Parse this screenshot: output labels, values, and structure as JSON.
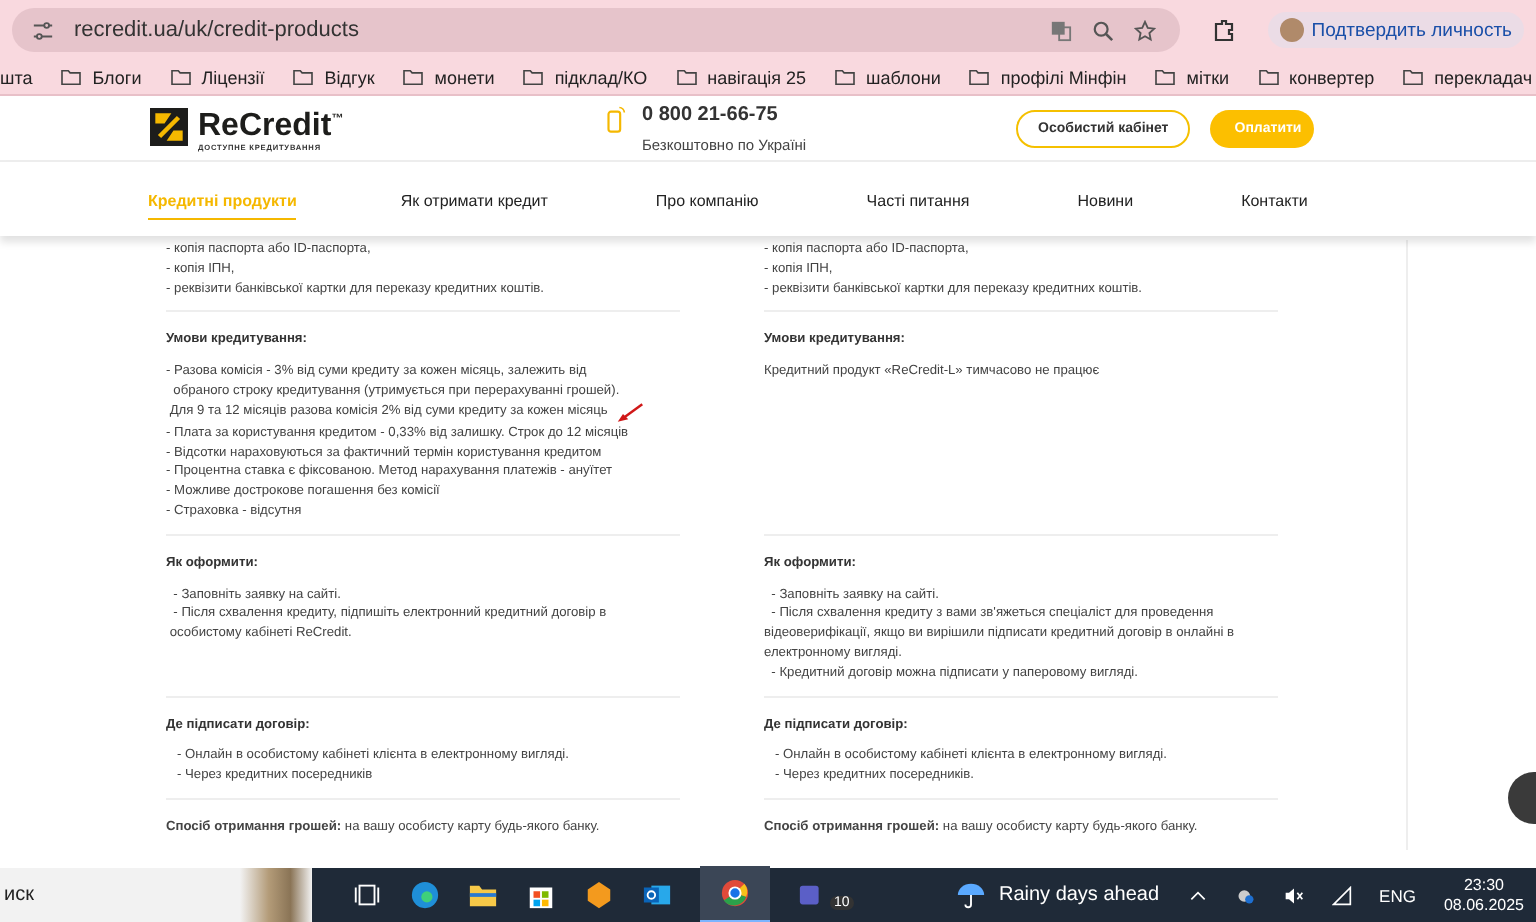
{
  "browser": {
    "url": "recredit.ua/uk/credit-products",
    "profile_button": "Подтвердить личность"
  },
  "bookmarks": [
    "шта",
    "Блоги",
    "Ліцензії",
    "Відгук",
    "монети",
    "підклад/КО",
    "навігація 25",
    "шаблони",
    "профілі Мінфін",
    "мітки",
    "конвертер",
    "перекладач"
  ],
  "header": {
    "logo": "ReCredit",
    "logo_tm": "™",
    "tagline": "ДОСТУПНЕ КРЕДИТУВАННЯ",
    "phone": "0 800 21-66-75",
    "phone_note": "Безкоштовно по Україні",
    "cabinet_button": "Особистий кабінет",
    "pay_button": "Оплатити"
  },
  "nav": [
    {
      "label": "Кредитні продукти",
      "selected": true
    },
    {
      "label": "Як отримати кредит",
      "selected": false
    },
    {
      "label": "Про компанію",
      "selected": false
    },
    {
      "label": "Часті питання",
      "selected": false
    },
    {
      "label": "Новини",
      "selected": false
    },
    {
      "label": "Контакти",
      "selected": false
    }
  ],
  "columns": [
    {
      "sections": [
        {
          "lines": [
            {
              "text": "- копія паспорта або ID-паспорта,",
              "marked": false
            },
            {
              "text": "- копія ІПН,",
              "marked": false
            },
            {
              "text": "- реквізити банківської картки для переказу кредитних коштів.",
              "marked": false
            }
          ]
        },
        {
          "heading": "Умови кредитування:",
          "lines": [
            {
              "text": "- Разова комісія - 3% від суми кредиту за кожен місяць, залежить від",
              "marked": false
            },
            {
              "text": "  обраного строку кредитування (утримується при перерахуванні грошей).",
              "marked": false
            },
            {
              "text": " Для 9 та 12 місяців разова комісія 2% від суми кредиту за кожен місяць",
              "marked": true
            },
            {
              "text": "- Плата за користування кредитом - 0,33% від залишку. Строк до 12 місяців",
              "marked": false
            },
            {
              "text": "- Відсотки нараховуються за фактичний термін користування кредитом",
              "marked": false
            },
            {
              "text": "- Процентна ставка є фіксованою. Метод нарахування платежів - ануїтет",
              "marked": false
            },
            {
              "text": "- Можливе дострокове погашення без комісії",
              "marked": false
            },
            {
              "text": "- Страховка - відсутня",
              "marked": false
            }
          ]
        },
        {
          "heading": "Як оформити:",
          "lines": [
            {
              "text": "  - Заповніть заявку на сайті.",
              "marked": false
            },
            {
              "text": "  - Після схвалення кредиту, підпишіть електронний кредитний договір в",
              "marked": false
            },
            {
              "text": " особистому кабінеті ReCredit.",
              "marked": false
            }
          ]
        },
        {
          "heading": "Де підписати договір:",
          "lines": [
            {
              "text": "   - Онлайн в особистому кабінеті клієнта в електронному вигляді.",
              "marked": false
            },
            {
              "text": "   - Через кредитних посередників",
              "marked": false
            }
          ]
        },
        {
          "lines": [
            {
              "text": "**Спосіб отримання грошей:** на вашу особисту карту будь-якого банку.",
              "marked": false
            }
          ]
        }
      ]
    },
    {
      "sections": [
        {
          "lines": [
            {
              "text": "- копія паспорта або ID-паспорта,",
              "marked": false
            },
            {
              "text": "- копія ІПН,",
              "marked": false
            },
            {
              "text": "- реквізити банківської картки для переказу кредитних коштів.",
              "marked": false
            }
          ]
        },
        {
          "heading": "Умови кредитування:",
          "lines": [
            {
              "text": "Кредитний продукт «ReCredit-L» тимчасово не працює",
              "marked": false
            }
          ]
        },
        {
          "heading": "Як оформити:",
          "lines": [
            {
              "text": "  - Заповніть заявку на сайті.",
              "marked": false
            },
            {
              "text": "  - Після схвалення кредиту з вами зв'яжеться спеціаліст для проведення",
              "marked": false
            },
            {
              "text": "відеоверифікації, якщо ви вирішили підписати кредитний договір в онлайні в",
              "marked": false
            },
            {
              "text": "електронному вигляді.",
              "marked": false
            },
            {
              "text": "  - Кредитний договір можна підписати у паперовому вигляді.",
              "marked": false
            }
          ]
        },
        {
          "heading": "Де підписати договір:",
          "lines": [
            {
              "text": "   - Онлайн в особистому кабінеті клієнта в електронному вигляді.",
              "marked": false
            },
            {
              "text": "   - Через кредитних посередників.",
              "marked": false
            }
          ]
        },
        {
          "lines": [
            {
              "text": "**Спосіб отримання грошей:** на вашу особисту карту будь-якого банку.",
              "marked": false
            }
          ]
        }
      ]
    }
  ],
  "taskbar": {
    "search": "иск",
    "teams_badge": "10",
    "weather": "Rainy days ahead",
    "language": "ENG",
    "time": "23:30",
    "date": "08.06.2025"
  }
}
